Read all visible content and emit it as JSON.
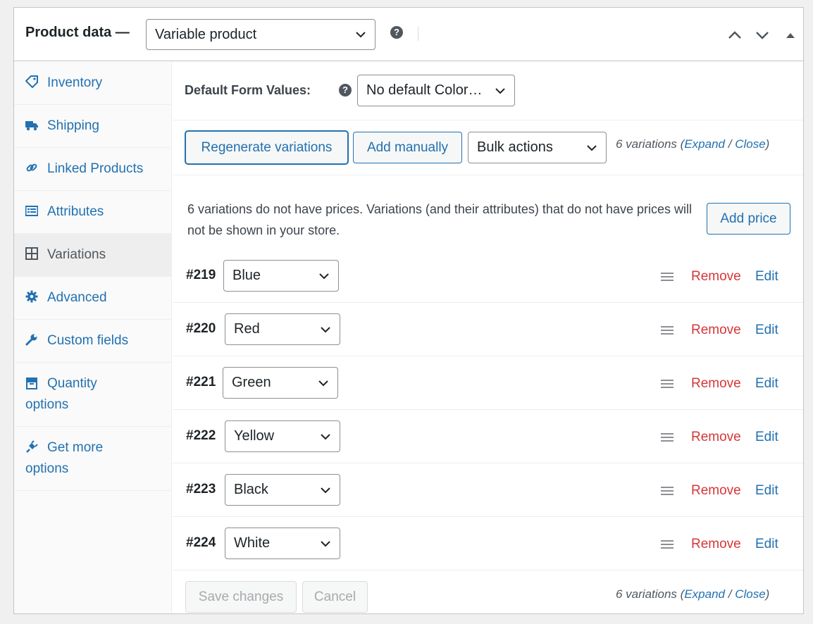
{
  "header": {
    "title": "Product data —",
    "product_type": "Variable product"
  },
  "sidebar": {
    "items": [
      {
        "label": "Inventory",
        "icon": "tag-icon"
      },
      {
        "label": "Shipping",
        "icon": "truck-icon"
      },
      {
        "label": "Linked Products",
        "icon": "link-icon"
      },
      {
        "label": "Attributes",
        "icon": "list-icon"
      },
      {
        "label": "Variations",
        "icon": "grid-icon"
      },
      {
        "label": "Advanced",
        "icon": "gear-icon"
      },
      {
        "label": "Custom fields",
        "icon": "wrench-icon"
      },
      {
        "label_line1": "Quantity",
        "label_line2": "options",
        "icon": "box-icon"
      },
      {
        "label_line1": "Get more",
        "label_line2": "options",
        "icon": "plugin-icon"
      }
    ]
  },
  "defaults": {
    "label": "Default Form Values:",
    "value": "No default Color…"
  },
  "toolbar": {
    "regenerate_label": "Regenerate variations",
    "add_manually_label": "Add manually",
    "bulk_actions_label": "Bulk actions",
    "count": "6 variations",
    "open_paren": "(",
    "expand": "Expand",
    "slash": " / ",
    "close": "Close",
    "close_paren": ")"
  },
  "notice": {
    "text": "6 variations do not have prices. Variations (and their attributes) that do not have prices will not be shown in your store.",
    "add_price_label": "Add price"
  },
  "variations": [
    {
      "id": "#219",
      "value": "Blue"
    },
    {
      "id": "#220",
      "value": "Red"
    },
    {
      "id": "#221",
      "value": "Green"
    },
    {
      "id": "#222",
      "value": "Yellow"
    },
    {
      "id": "#223",
      "value": "Black"
    },
    {
      "id": "#224",
      "value": "White"
    }
  ],
  "row_actions": {
    "remove": "Remove",
    "edit": "Edit"
  },
  "footer": {
    "save_label": "Save changes",
    "cancel_label": "Cancel",
    "count": "6 variations",
    "open_paren": "(",
    "expand": "Expand",
    "slash": " / ",
    "close": "Close",
    "close_paren": ")"
  },
  "colors": {
    "link": "#2271b1",
    "remove": "#d63638",
    "border": "#c3c4c7"
  }
}
